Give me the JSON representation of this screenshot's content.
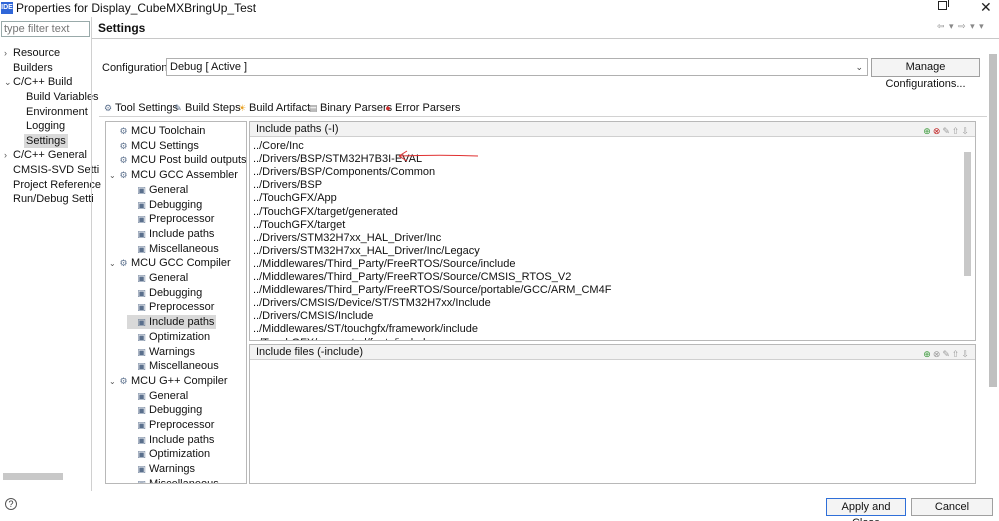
{
  "window": {
    "app_icon": "IDE",
    "title": "Properties for Display_CubeMXBringUp_Test",
    "restore_icon": "restore-icon",
    "close_glyph": "✕"
  },
  "nav": {
    "filter_placeholder": "type filter text",
    "items": [
      {
        "label": "Resource",
        "arrow": "›"
      },
      {
        "label": "Builders",
        "arrow": ""
      },
      {
        "label": "C/C++ Build",
        "arrow": "⌄"
      },
      {
        "label": "Build Variables",
        "arrow": ""
      },
      {
        "label": "Environment",
        "arrow": ""
      },
      {
        "label": "Logging",
        "arrow": ""
      },
      {
        "label": "Settings",
        "arrow": "",
        "selected": true
      },
      {
        "label": "C/C++ General",
        "arrow": "›"
      },
      {
        "label": "CMSIS-SVD Setti",
        "arrow": ""
      },
      {
        "label": "Project Reference",
        "arrow": ""
      },
      {
        "label": "Run/Debug Setti",
        "arrow": ""
      }
    ]
  },
  "header": {
    "title": "Settings",
    "nav_glyphs": "⇦ ▾ ⇨ ▾ ▾"
  },
  "configuration": {
    "label": "Configuration:",
    "value": "Debug  [ Active ]",
    "manage_button": "Manage Configurations..."
  },
  "tabs": [
    {
      "label": "Tool Settings",
      "icon": "⚙"
    },
    {
      "label": "Build Steps",
      "icon": "✎"
    },
    {
      "label": "Build Artifact",
      "icon": "☀"
    },
    {
      "label": "Binary Parsers",
      "icon": "▤"
    },
    {
      "label": "Error Parsers",
      "icon": "●"
    }
  ],
  "tree": {
    "items": [
      {
        "label": "MCU Toolchain",
        "level": 0,
        "expander": ""
      },
      {
        "label": "MCU Settings",
        "level": 0,
        "expander": ""
      },
      {
        "label": "MCU Post build outputs",
        "level": 0,
        "expander": ""
      },
      {
        "label": "MCU GCC Assembler",
        "level": 0,
        "expander": "⌄"
      },
      {
        "label": "General",
        "level": 1,
        "expander": ""
      },
      {
        "label": "Debugging",
        "level": 1,
        "expander": ""
      },
      {
        "label": "Preprocessor",
        "level": 1,
        "expander": ""
      },
      {
        "label": "Include paths",
        "level": 1,
        "expander": ""
      },
      {
        "label": "Miscellaneous",
        "level": 1,
        "expander": ""
      },
      {
        "label": "MCU GCC Compiler",
        "level": 0,
        "expander": "⌄"
      },
      {
        "label": "General",
        "level": 1,
        "expander": ""
      },
      {
        "label": "Debugging",
        "level": 1,
        "expander": ""
      },
      {
        "label": "Preprocessor",
        "level": 1,
        "expander": ""
      },
      {
        "label": "Include paths",
        "level": 1,
        "expander": "",
        "selected": true
      },
      {
        "label": "Optimization",
        "level": 1,
        "expander": ""
      },
      {
        "label": "Warnings",
        "level": 1,
        "expander": ""
      },
      {
        "label": "Miscellaneous",
        "level": 1,
        "expander": ""
      },
      {
        "label": "MCU G++ Compiler",
        "level": 0,
        "expander": "⌄"
      },
      {
        "label": "General",
        "level": 1,
        "expander": ""
      },
      {
        "label": "Debugging",
        "level": 1,
        "expander": ""
      },
      {
        "label": "Preprocessor",
        "level": 1,
        "expander": ""
      },
      {
        "label": "Include paths",
        "level": 1,
        "expander": ""
      },
      {
        "label": "Optimization",
        "level": 1,
        "expander": ""
      },
      {
        "label": "Warnings",
        "level": 1,
        "expander": ""
      },
      {
        "label": "Miscellaneous",
        "level": 1,
        "expander": ""
      }
    ]
  },
  "include_paths": {
    "title": "Include paths (-I)",
    "tools": [
      "add",
      "delete",
      "edit",
      "move-up",
      "move-down"
    ],
    "paths": [
      "../Core/Inc",
      "../Drivers/BSP/STM32H7B3I-EVAL",
      "../Drivers/BSP/Components/Common",
      "../Drivers/BSP",
      "../TouchGFX/App",
      "../TouchGFX/target/generated",
      "../TouchGFX/target",
      "../Drivers/STM32H7xx_HAL_Driver/Inc",
      "../Drivers/STM32H7xx_HAL_Driver/Inc/Legacy",
      "../Middlewares/Third_Party/FreeRTOS/Source/include",
      "../Middlewares/Third_Party/FreeRTOS/Source/CMSIS_RTOS_V2",
      "../Middlewares/Third_Party/FreeRTOS/Source/portable/GCC/ARM_CM4F",
      "../Drivers/CMSIS/Device/ST/STM32H7xx/Include",
      "../Drivers/CMSIS/Include",
      "../Middlewares/ST/touchgfx/framework/include",
      "../TouchGFX/generated/fonts/include"
    ]
  },
  "include_files": {
    "title": "Include files (-include)",
    "tools": [
      "add",
      "delete",
      "edit",
      "move-up",
      "move-down"
    ]
  },
  "annotation": {
    "color": "#e03030",
    "points_to": "../Drivers/BSP/STM32H7B3I-EVAL"
  },
  "footer": {
    "help_glyph": "?",
    "apply_button": "Apply and Close",
    "cancel_button": "Cancel"
  }
}
